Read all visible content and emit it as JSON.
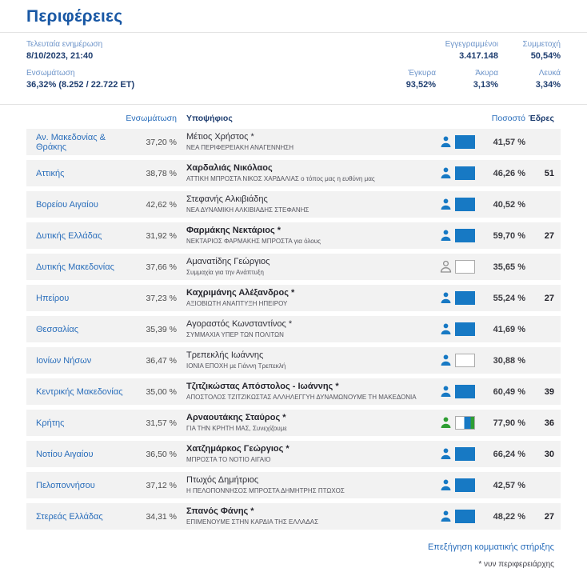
{
  "title": "Περιφέρειες",
  "colors": {
    "accent_blue": "#1779c4",
    "support_green": "#2f9e33",
    "link_blue": "#2a6ebb",
    "title_blue": "#1857a4"
  },
  "summary": {
    "last_update_label": "Τελευταία ενημέρωση",
    "last_update_value": "8/10/2023, 21:40",
    "integration_label": "Ενσωμάτωση",
    "integration_value": "36,32% (8.252 / 22.722 ΕΤ)",
    "registered_label": "Εγγεγραμμένοι",
    "registered_value": "3.417.148",
    "turnout_label": "Συμμετοχή",
    "turnout_value": "50,54%",
    "valid_label": "Έγκυρα",
    "valid_value": "93,52%",
    "invalid_label": "Άκυρα",
    "invalid_value": "3,13%",
    "blank_label": "Λευκά",
    "blank_value": "3,34%"
  },
  "table": {
    "columns": {
      "integration": "Ενσωμάτωση",
      "candidate": "Υποψήφιος",
      "percent": "Ποσοστό",
      "seats": "Έδρες"
    },
    "rows": [
      {
        "region": "Αν. Μακεδονίας & Θράκης",
        "integration": "37,20 %",
        "candidate": "Μέτιος Χρήστος *",
        "party": "ΝΕΑ ΠΕΡΙΦΕΡΕΙΑΚΗ ΑΝΑΓΕΝΝΗΣΗ",
        "person": "blue",
        "box": "blue",
        "percent": "41,57 %",
        "seats": ""
      },
      {
        "region": "Αττικής",
        "integration": "38,78 %",
        "candidate": "Χαρδαλιάς Νικόλαος",
        "party": "ΑΤΤΙΚΗ ΜΠΡΟΣΤΑ ΝΙΚΟΣ ΧΑΡΔΑΛΙΑΣ ο τόπος μας η ευθύνη μας",
        "person": "blue",
        "box": "blue",
        "percent": "46,26 %",
        "seats": "51"
      },
      {
        "region": "Βορείου Αιγαίου",
        "integration": "42,62 %",
        "candidate": "Στεφανής Αλκιβιάδης",
        "party": "ΝΕΑ ΔΥΝΑΜΙΚΗ ΑΛΚΙΒΙΑΔΗΣ ΣΤΕΦΑΝΗΣ",
        "person": "blue",
        "box": "blue",
        "percent": "40,52 %",
        "seats": ""
      },
      {
        "region": "Δυτικής Ελλάδας",
        "integration": "31,92 %",
        "candidate": "Φαρμάκης Νεκτάριος *",
        "party": "ΝΕΚΤΑΡΙΟΣ ΦΑΡΜΑΚΗΣ ΜΠΡΟΣΤΑ για όλους",
        "person": "blue",
        "box": "blue",
        "percent": "59,70 %",
        "seats": "27"
      },
      {
        "region": "Δυτικής Μακεδονίας",
        "integration": "37,66 %",
        "candidate": "Αμανατίδης Γεώργιος",
        "party": "Συμμαχία για την Ανάπτυξη",
        "person": "outline",
        "box": "white",
        "percent": "35,65 %",
        "seats": ""
      },
      {
        "region": "Ηπείρου",
        "integration": "37,23 %",
        "candidate": "Καχριμάνης Αλέξανδρος *",
        "party": "ΑΞΙΟΒΙΩΤΗ ΑΝΑΠΤΥΞΗ ΗΠΕΙΡΟΥ",
        "person": "blue",
        "box": "blue",
        "percent": "55,24 %",
        "seats": "27"
      },
      {
        "region": "Θεσσαλίας",
        "integration": "35,39 %",
        "candidate": "Αγοραστός Κωνσταντίνος *",
        "party": "ΣΥΜΜΑΧΙΑ ΥΠΕΡ ΤΩΝ ΠΟΛΙΤΩΝ",
        "person": "blue",
        "box": "blue",
        "percent": "41,69 %",
        "seats": ""
      },
      {
        "region": "Ιονίων Νήσων",
        "integration": "36,47 %",
        "candidate": "Τρεπεκλής Ιωάννης",
        "party": "ΙΟΝΙΑ ΕΠΟΧΗ με Γιάννη Τρεπεκλή",
        "person": "blue",
        "box": "white",
        "percent": "30,88 %",
        "seats": ""
      },
      {
        "region": "Κεντρικής Μακεδονίας",
        "integration": "35,00 %",
        "candidate": "Τζιτζικώστας Απόστολος - Ιωάννης *",
        "party": "ΑΠΟΣΤΟΛΟΣ ΤΖΙΤΖΙΚΩΣΤΑΣ ΑΛΛΗΛΕΓΓΥΗ ΔΥΝΑΜΩΝΟΥΜΕ ΤΗ ΜΑΚΕΔΟΝΙΑ",
        "person": "blue",
        "box": "blue",
        "percent": "60,49 %",
        "seats": "39"
      },
      {
        "region": "Κρήτης",
        "integration": "31,57 %",
        "candidate": "Αρναουτάκης Σταύρος *",
        "party": "ΓΙΑ ΤΗΝ ΚΡΗΤΗ ΜΑΣ, Συνεχίζουμε",
        "person": "green",
        "box": "mixed",
        "percent": "77,90 %",
        "seats": "36"
      },
      {
        "region": "Νοτίου Αιγαίου",
        "integration": "36,50 %",
        "candidate": "Χατζημάρκος Γεώργιος *",
        "party": "ΜΠΡΟΣΤΑ ΤΟ ΝΟΤΙΟ ΑΙΓΑΙΟ",
        "person": "blue",
        "box": "blue",
        "percent": "66,24 %",
        "seats": "30"
      },
      {
        "region": "Πελοποννήσου",
        "integration": "37,12 %",
        "candidate": "Πτωχός Δημήτριος",
        "party": "Η ΠΕΛΟΠΟΝΝΗΣΟΣ ΜΠΡΟΣΤΑ ΔΗΜΗΤΡΗΣ ΠΤΩΧΟΣ",
        "person": "blue",
        "box": "blue",
        "percent": "42,57 %",
        "seats": ""
      },
      {
        "region": "Στερεάς Ελλάδας",
        "integration": "34,31 %",
        "candidate": "Σπανός Φάνης *",
        "party": "ΕΠΙΜΕΝΟΥΜΕ ΣΤΗΝ ΚΑΡΔΙΑ ΤΗΣ ΕΛΛΑΔΑΣ",
        "person": "blue",
        "box": "blue",
        "percent": "48,22 %",
        "seats": "27"
      }
    ]
  },
  "footer": {
    "legend_link": "Επεξήγηση κομματικής στήριξης",
    "incumbent_note": "* νυν περιφερειάρχης"
  }
}
